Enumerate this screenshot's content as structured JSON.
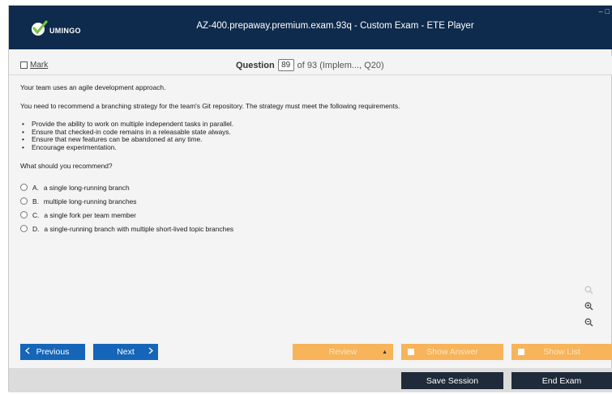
{
  "window": {
    "title": "AZ-400.prepaway.premium.exam.93q - Custom Exam - ETE Player",
    "logo_text": "UMINGO",
    "controls": [
      "–",
      "□"
    ]
  },
  "question_bar": {
    "mark_label": "Mark",
    "question_label": "Question",
    "question_number": "89",
    "question_of": "of 93 (Implem..., Q20)"
  },
  "question": {
    "intro": "Your team uses an agile development approach.",
    "task": "You need to recommend a branching strategy for the team's Git repository. The strategy must meet the following requirements.",
    "requirements": [
      "Provide the ability to work on multiple independent tasks in parallel.",
      "Ensure that checked-in code remains in a releasable state always.",
      "Ensure that new features can be abandoned at any time.",
      "Encourage experimentation."
    ],
    "prompt": "What should you recommend?",
    "options": [
      {
        "letter": "A.",
        "text": "a single long-running branch"
      },
      {
        "letter": "B.",
        "text": "multiple long-running branches"
      },
      {
        "letter": "C.",
        "text": "a single fork per team member"
      },
      {
        "letter": "D.",
        "text": "a single-running branch with multiple short-lived topic branches"
      }
    ]
  },
  "zoom": {
    "icons": [
      "search-icon",
      "zoom-in-icon",
      "zoom-out-icon"
    ]
  },
  "nav": {
    "previous_label": "Previous",
    "next_label": "Next",
    "review_label": "Review",
    "show_answer_label": "Show Answer",
    "show_list_label": "Show List"
  },
  "footer": {
    "save_label": "Save Session",
    "end_label": "End Exam"
  },
  "colors": {
    "titlebar": "#0e2a4c",
    "nav_blue": "#1565b8",
    "accent_orange": "#f7b45a",
    "dark_button": "#1f2a3a"
  }
}
